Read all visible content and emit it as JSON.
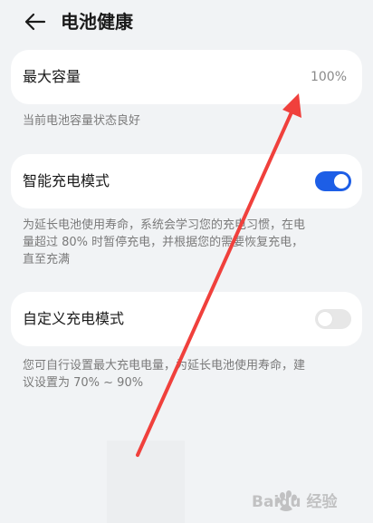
{
  "header": {
    "title": "电池健康",
    "back_icon": "arrow-left-icon"
  },
  "capacity": {
    "label": "最大容量",
    "value": "100%",
    "description": "当前电池容量状态良好"
  },
  "smart_charging": {
    "label": "智能充电模式",
    "enabled": true,
    "description_line1": "为延长电池使用寿命，系统会学习您的充电习惯，在电",
    "description_line2": "量超过 80% 时暂停充电，并根据您的需要恢复充电，",
    "description_line3": "直至充满"
  },
  "custom_charging": {
    "label": "自定义充电模式",
    "enabled": false,
    "description_line1": "您可自行设置最大充电电量，为延长电池使用寿命，建",
    "description_line2": "议设置为 70% ~ 90%"
  },
  "colors": {
    "background": "#f1f3f5",
    "toggle_on": "#1d5ee6",
    "annotation_arrow": "#f0403c"
  },
  "watermark": {
    "text": "Baidu 经验",
    "icon": "paw-logo-icon"
  }
}
